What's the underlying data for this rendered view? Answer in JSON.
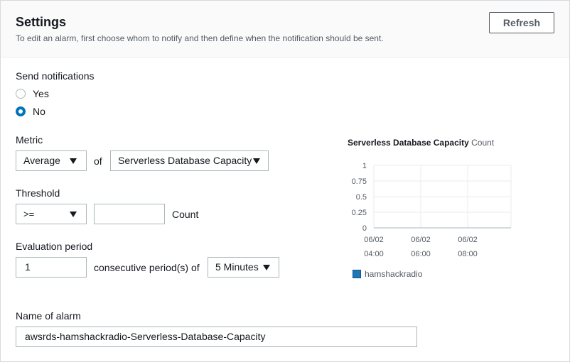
{
  "header": {
    "title": "Settings",
    "subtitle": "To edit an alarm, first choose whom to notify and then define when the notification should be sent.",
    "refresh_label": "Refresh"
  },
  "notifications": {
    "label": "Send notifications",
    "options": [
      {
        "label": "Yes",
        "selected": false
      },
      {
        "label": "No",
        "selected": true
      }
    ]
  },
  "metric": {
    "label": "Metric",
    "statistic": "Average",
    "of_label": "of",
    "metric_name": "Serverless Database Capacity"
  },
  "threshold": {
    "label": "Threshold",
    "operator": ">=",
    "value": "",
    "unit": "Count"
  },
  "evaluation": {
    "label": "Evaluation period",
    "periods": "1",
    "consecutive_label": "consecutive period(s) of",
    "period_length": "5 Minutes"
  },
  "alarm_name": {
    "label": "Name of alarm",
    "value": "awsrds-hamshackradio-Serverless-Database-Capacity"
  },
  "chart_data": {
    "type": "line",
    "title": "Serverless Database Capacity",
    "unit": "Count",
    "y_ticks": [
      "1",
      "0.75",
      "0.5",
      "0.25",
      "0"
    ],
    "x_ticks": [
      {
        "date": "06/02",
        "time": "04:00"
      },
      {
        "date": "06/02",
        "time": "06:00"
      },
      {
        "date": "06/02",
        "time": "08:00"
      }
    ],
    "ylim": [
      0,
      1
    ],
    "grid": true,
    "series": [
      {
        "name": "hamshackradio",
        "color": "#1f77b4",
        "values": []
      }
    ],
    "legend": "bottom-left"
  }
}
